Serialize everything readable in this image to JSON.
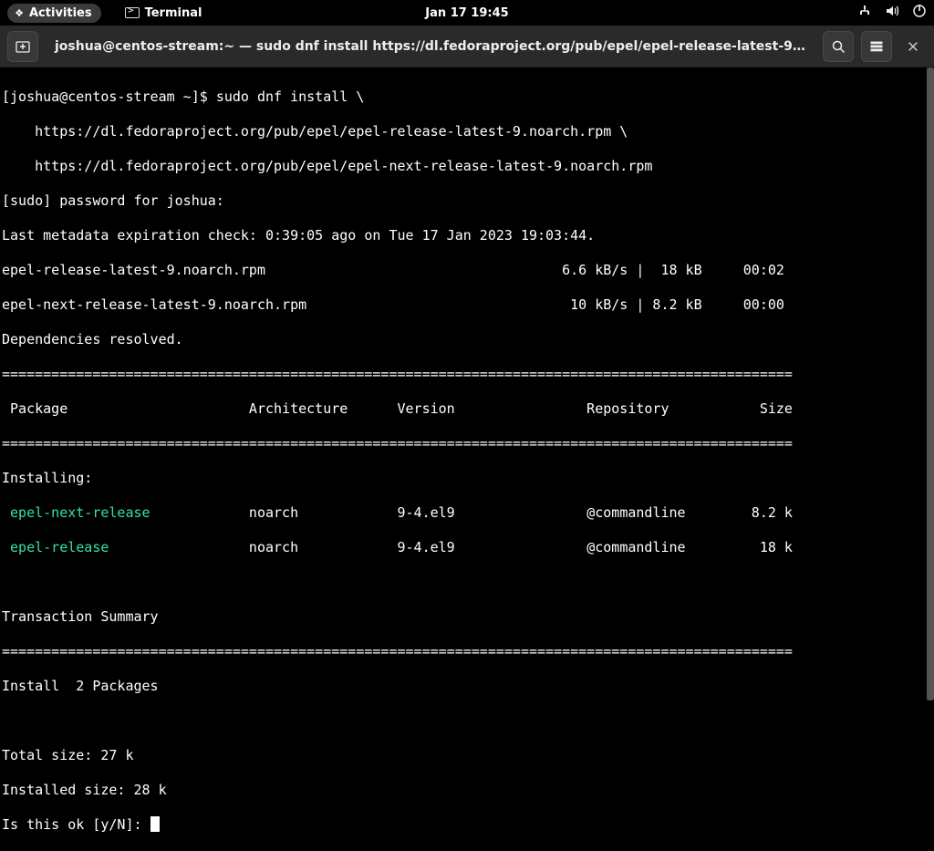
{
  "topbar": {
    "activities": "Activities",
    "app_name": "Terminal",
    "clock": "Jan 17  19:45"
  },
  "window": {
    "title": "joshua@centos-stream:~ — sudo dnf install https://dl.fedoraproject.org/pub/epel/epel-release-latest-9.noarch.rpm …"
  },
  "term": {
    "prompt": "[joshua@centos-stream ~]$ ",
    "cmd0": "sudo dnf install \\",
    "cmd1": "    https://dl.fedoraproject.org/pub/epel/epel-release-latest-9.noarch.rpm \\",
    "cmd2": "    https://dl.fedoraproject.org/pub/epel/epel-next-release-latest-9.noarch.rpm",
    "sudo": "[sudo] password for joshua: ",
    "meta": "Last metadata expiration check: 0:39:05 ago on Tue 17 Jan 2023 19:03:44.",
    "dl1": "epel-release-latest-9.noarch.rpm                                    6.6 kB/s |  18 kB     00:02    ",
    "dl2": "epel-next-release-latest-9.noarch.rpm                                10 kB/s | 8.2 kB     00:00    ",
    "dep": "Dependencies resolved.",
    "rule": "================================================================================================",
    "hdr": " Package                      Architecture      Version                Repository           Size",
    "installing": "Installing:",
    "pkg1_name": " epel-next-release",
    "pkg1_rest": "            noarch            9-4.el9                @commandline        8.2 k",
    "pkg2_name": " epel-release",
    "pkg2_rest": "                 noarch            9-4.el9                @commandline         18 k",
    "tsummary": "Transaction Summary",
    "install_count": "Install  2 Packages",
    "total_size": "Total size: 27 k",
    "installed_size": "Installed size: 28 k",
    "confirm": "Is this ok [y/N]: "
  }
}
